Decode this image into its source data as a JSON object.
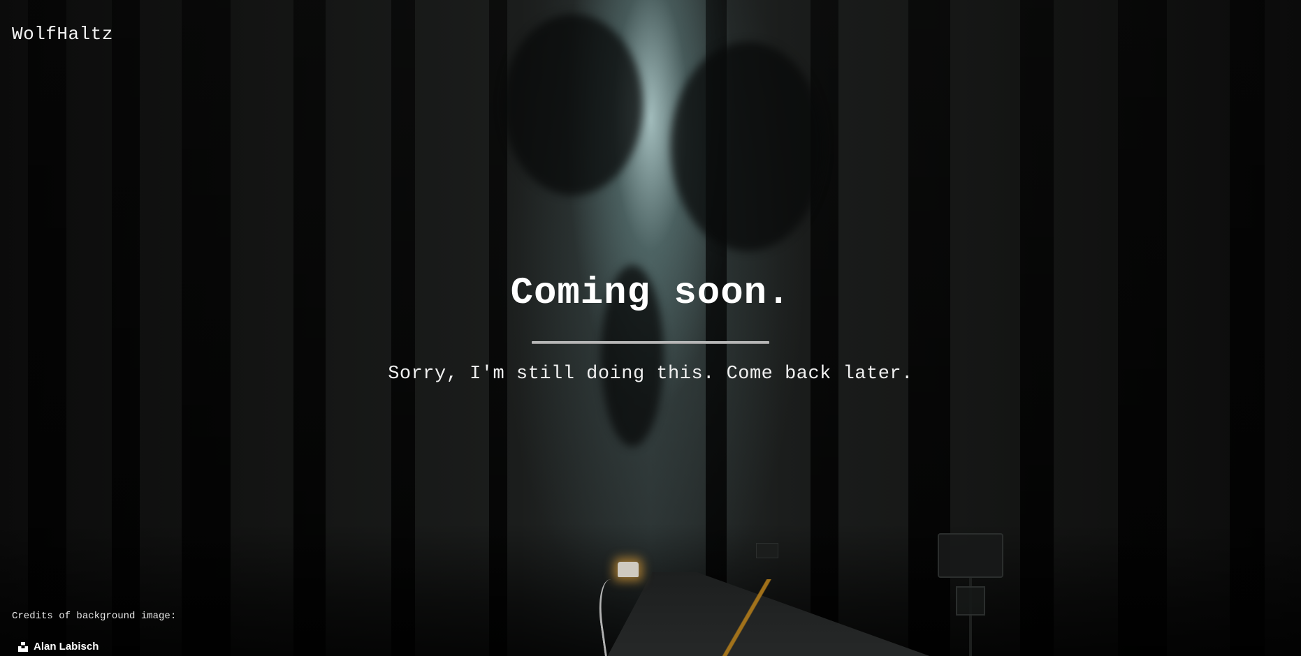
{
  "header": {
    "brand": "WolfHaltz"
  },
  "hero": {
    "title": "Coming soon.",
    "subtitle": "Sorry, I'm still doing this. Come back later."
  },
  "footer": {
    "credits_label": "Credits of background image:",
    "photographer": "Alan Labisch",
    "photographer_icon": "unsplash-icon"
  },
  "colors": {
    "text": "#ffffff",
    "background": "#0b0b0b",
    "divider": "#b5b5b5"
  }
}
